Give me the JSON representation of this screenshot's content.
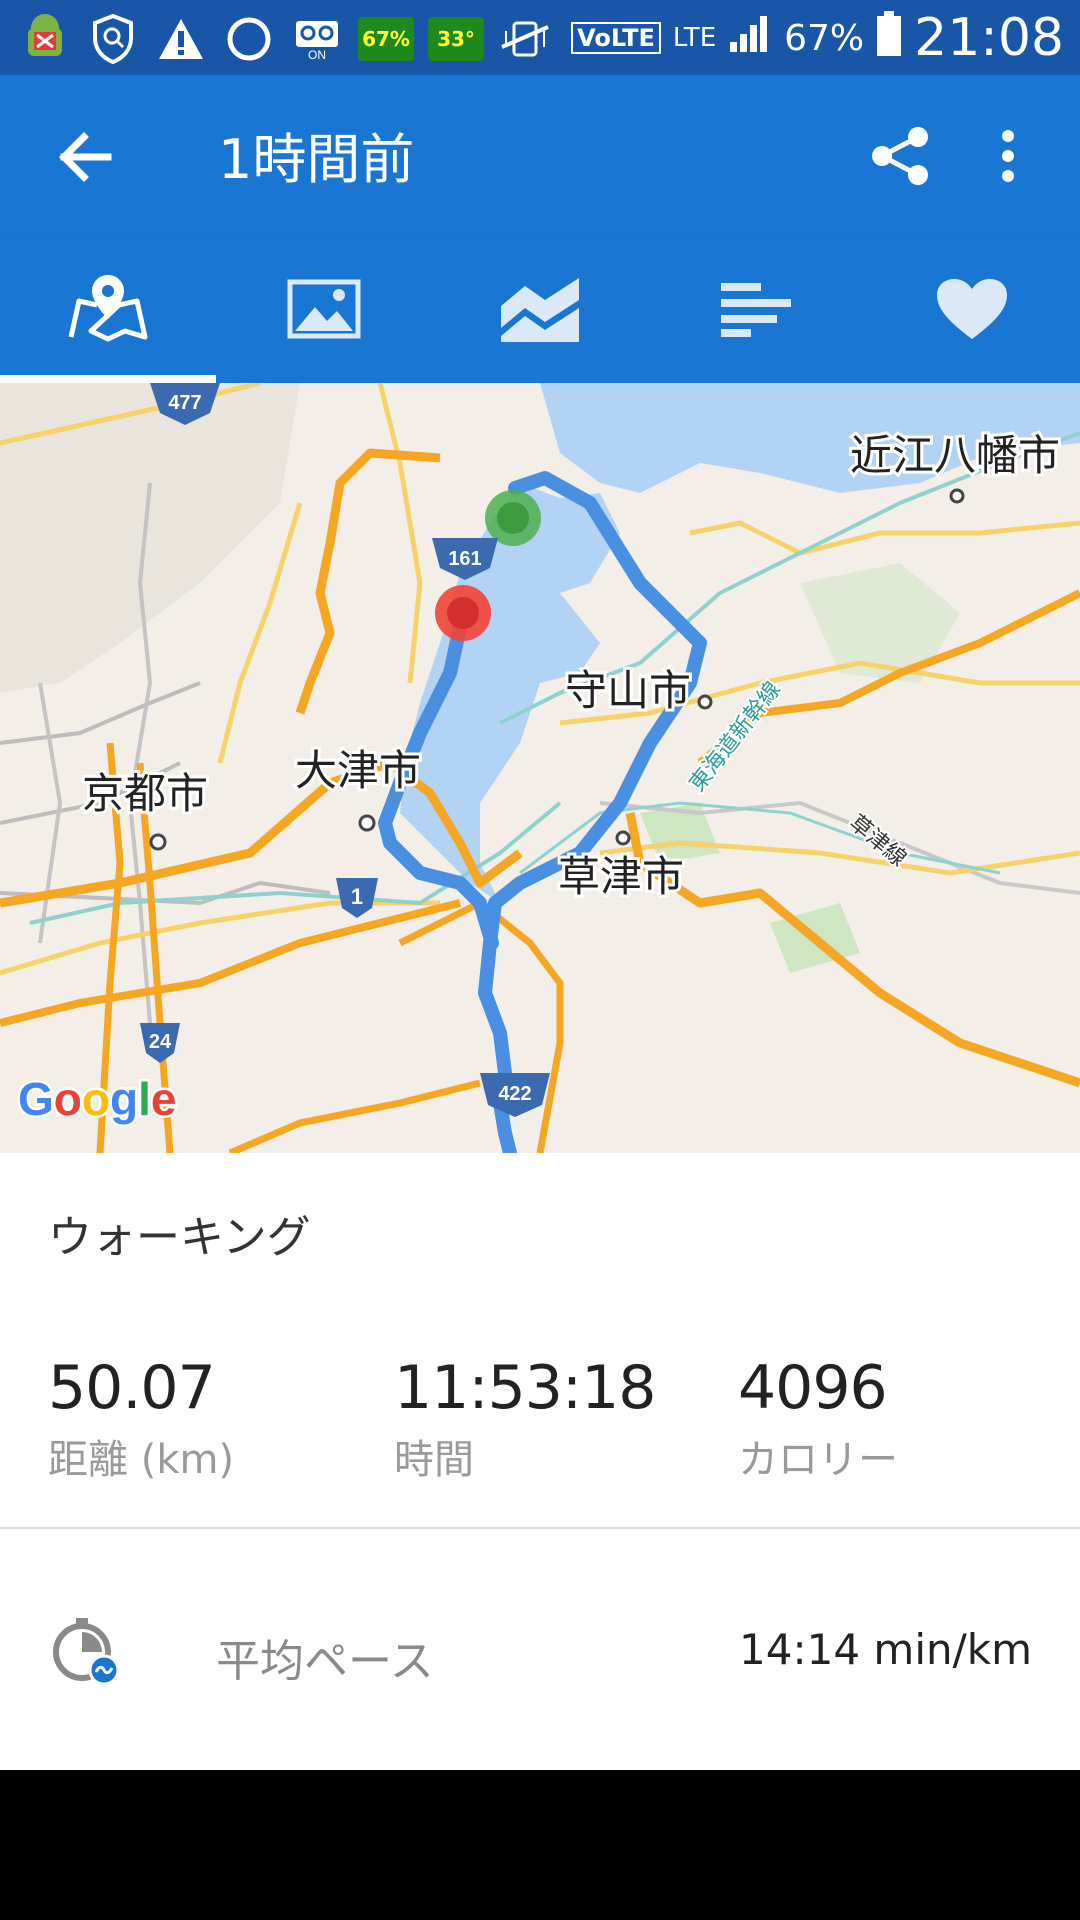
{
  "status_bar": {
    "badge_battery_app": "67%",
    "badge_temp": "33°",
    "network": "LTE",
    "volte": "VoLTE",
    "battery_percent": "67%",
    "time": "21:08"
  },
  "app_bar": {
    "title": "1時間前",
    "back_icon": "arrow-left-icon",
    "share_icon": "share-icon",
    "more_icon": "more-vert-icon"
  },
  "tabs": [
    {
      "name": "map",
      "icon": "map-icon",
      "selected": true
    },
    {
      "name": "photos",
      "icon": "image-icon",
      "selected": false
    },
    {
      "name": "charts",
      "icon": "area-chart-icon",
      "selected": false
    },
    {
      "name": "splits",
      "icon": "bars-icon",
      "selected": false
    },
    {
      "name": "favorite",
      "icon": "heart-icon",
      "selected": false
    }
  ],
  "map": {
    "labels": {
      "omihachiman": "近江八幡市",
      "moriyama": "守山市",
      "kyoto": "京都市",
      "otsu": "大津市",
      "kusatsu": "草津市",
      "shinkansen": "東海道新幹線",
      "kusatsu_line": "草津線"
    },
    "routes": {
      "r477": "477",
      "r161": "161",
      "r1": "1",
      "r24": "24",
      "r422": "422"
    },
    "attribution": "Google",
    "start_color": "#4caf50",
    "end_color": "#f44336",
    "route_color": "#4a90e2"
  },
  "activity_type": "ウォーキング",
  "stats": [
    {
      "value": "50.07",
      "label": "距離 (km)"
    },
    {
      "value": "11:53:18",
      "label": "時間"
    },
    {
      "value": "4096",
      "label": "カロリー"
    }
  ],
  "pace": {
    "label": "平均ペース",
    "value": "14:14 min/km",
    "icon": "stopwatch-icon"
  },
  "colors": {
    "primary": "#1976d2",
    "status_bar": "#1a56a8"
  }
}
